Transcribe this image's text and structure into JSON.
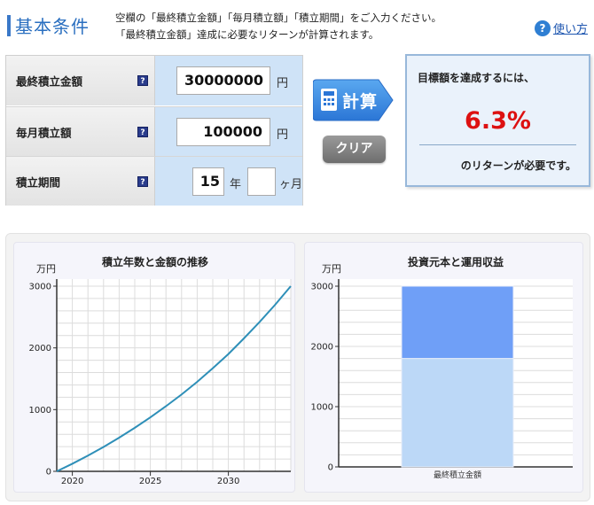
{
  "header": {
    "title": "基本条件",
    "desc_line1": "空欄の「最終積立金額」「毎月積立額」「積立期間」をご入力ください。",
    "desc_line2": "「最終積立金額」達成に必要なリターンが計算されます。",
    "help_label": "使い方"
  },
  "form": {
    "row1": {
      "label": "最終積立金額",
      "value": "30000000",
      "unit": "円"
    },
    "row2": {
      "label": "毎月積立額",
      "value": "100000",
      "unit": "円"
    },
    "row3": {
      "label": "積立期間",
      "years": "15",
      "years_unit": "年",
      "months": "",
      "months_unit": "ヶ月"
    },
    "help_glyph": "?"
  },
  "buttons": {
    "calc": "計算",
    "clear": "クリア"
  },
  "result": {
    "heading": "目標額を達成するには、",
    "rate": "6.3%",
    "tail": "のリターンが必要です。"
  },
  "colors": {
    "accent": "#2a6fc0",
    "rate": "#dd1111",
    "line": "#2e8fb8",
    "bar_top": "#6f9ff7",
    "bar_bottom": "#bcd8f7"
  },
  "chart_data": [
    {
      "type": "line",
      "title": "積立年数と金額の推移",
      "ylabel": "万円",
      "ylim": [
        0,
        3000
      ],
      "yticks": [
        0,
        1000,
        2000,
        3000
      ],
      "xlim": [
        2019,
        2034
      ],
      "xticks": [
        "2020",
        "2025",
        "2030"
      ],
      "x": [
        2019,
        2020,
        2021,
        2022,
        2023,
        2024,
        2025,
        2026,
        2027,
        2028,
        2029,
        2030,
        2031,
        2032,
        2033,
        2034
      ],
      "y": [
        0,
        123,
        255,
        395,
        545,
        705,
        875,
        1055,
        1245,
        1450,
        1670,
        1900,
        2155,
        2420,
        2700,
        3000
      ],
      "grid": true
    },
    {
      "type": "bar",
      "title": "投資元本と運用収益",
      "ylabel": "万円",
      "ylim": [
        0,
        3000
      ],
      "yticks": [
        0,
        1000,
        2000,
        3000
      ],
      "categories": [
        "最終積立金額"
      ],
      "series": [
        {
          "values": [
            1800
          ]
        },
        {
          "values": [
            1200
          ]
        }
      ],
      "grid": true
    }
  ]
}
